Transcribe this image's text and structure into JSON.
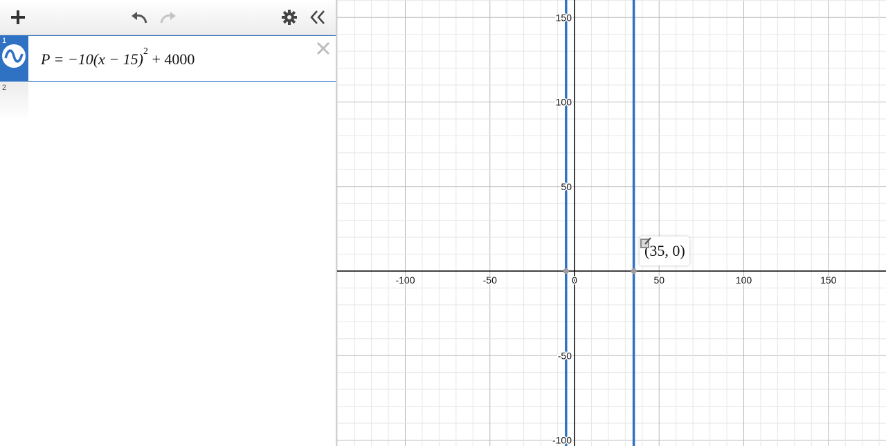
{
  "toolbar": {
    "add_icon": "plus-icon",
    "undo_icon": "undo-icon",
    "redo_icon": "redo-icon",
    "settings_icon": "gear-icon",
    "collapse_icon": "double-chevron-left-icon"
  },
  "expressions": [
    {
      "index": "1",
      "icon": "sine-wave-icon",
      "lhs": "P = −10(x − 15)",
      "exponent": "2",
      "rhs": " + 4000",
      "color": "#2f72c4",
      "active": true
    },
    {
      "index": "2",
      "lhs": "",
      "exponent": "",
      "rhs": "",
      "active": false
    }
  ],
  "graph": {
    "x_ticks": [
      "-100",
      "-50",
      "0",
      "50",
      "100",
      "150"
    ],
    "y_ticks": [
      "150",
      "100",
      "50",
      "-50",
      "-100"
    ],
    "curve_color": "#2f72c4",
    "grid_color": "#e6e6e6",
    "major_grid_color": "#b8b8b8",
    "axis_color": "#000000",
    "roots_x": [
      -5,
      35
    ],
    "point_label": {
      "text": "(35, 0)",
      "x": 35,
      "y": 0
    }
  }
}
